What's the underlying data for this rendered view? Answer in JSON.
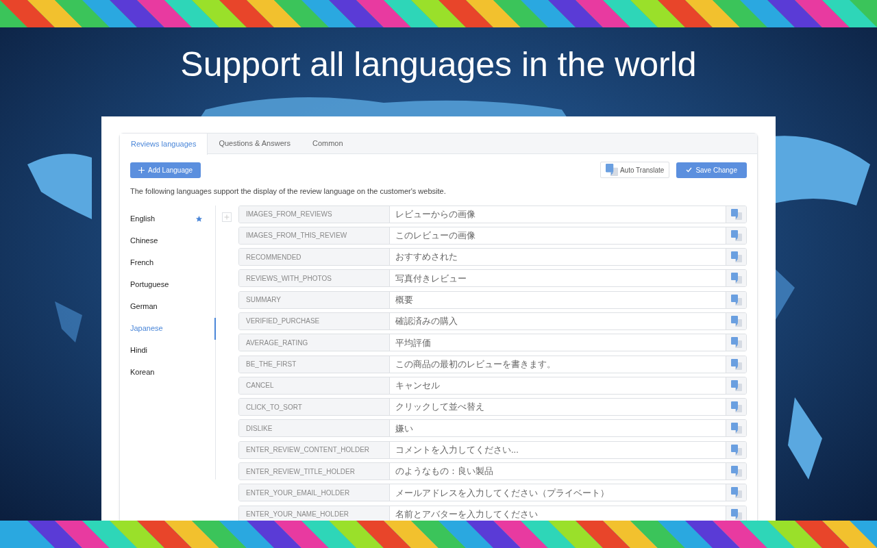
{
  "headline": "Support all languages in the world",
  "tabs": [
    {
      "label": "Reviews languages",
      "selected": true
    },
    {
      "label": "Questions & Answers",
      "selected": false
    },
    {
      "label": "Common",
      "selected": false
    }
  ],
  "add_button": "Add Language",
  "auto_translate_button": "Auto Translate",
  "save_button": "Save Change",
  "description": "The following languages support the display of the review language on the customer's website.",
  "languages": [
    {
      "name": "English",
      "selected": false,
      "default": true
    },
    {
      "name": "Chinese",
      "selected": false,
      "default": false
    },
    {
      "name": "French",
      "selected": false,
      "default": false
    },
    {
      "name": "Portuguese",
      "selected": false,
      "default": false
    },
    {
      "name": "German",
      "selected": false,
      "default": false
    },
    {
      "name": "Japanese",
      "selected": true,
      "default": false
    },
    {
      "name": "Hindi",
      "selected": false,
      "default": false
    },
    {
      "name": "Korean",
      "selected": false,
      "default": false
    }
  ],
  "rows": [
    {
      "key": "IMAGES_FROM_REVIEWS",
      "value": "レビューからの画像"
    },
    {
      "key": "IMAGES_FROM_THIS_REVIEW",
      "value": "このレビューの画像"
    },
    {
      "key": "RECOMMENDED",
      "value": "おすすめされた"
    },
    {
      "key": "REVIEWS_WITH_PHOTOS",
      "value": "写真付きレビュー"
    },
    {
      "key": "SUMMARY",
      "value": "概要"
    },
    {
      "key": "VERIFIED_PURCHASE",
      "value": "確認済みの購入"
    },
    {
      "key": "AVERAGE_RATING",
      "value": "平均評価"
    },
    {
      "key": "BE_THE_FIRST",
      "value": "この商品の最初のレビューを書きます。"
    },
    {
      "key": "CANCEL",
      "value": "キャンセル"
    },
    {
      "key": "CLICK_TO_SORT",
      "value": "クリックして並べ替え"
    },
    {
      "key": "DISLIKE",
      "value": "嫌い"
    },
    {
      "key": "ENTER_REVIEW_CONTENT_HOLDER",
      "value": "コメントを入力してください..."
    },
    {
      "key": "ENTER_REVIEW_TITLE_HOLDER",
      "value": "のようなもの：良い製品"
    },
    {
      "key": "ENTER_YOUR_EMAIL_HOLDER",
      "value": "メールアドレスを入力してください（プライベート）"
    },
    {
      "key": "ENTER_YOUR_NAME_HOLDER",
      "value": "名前とアバターを入力してください"
    }
  ]
}
